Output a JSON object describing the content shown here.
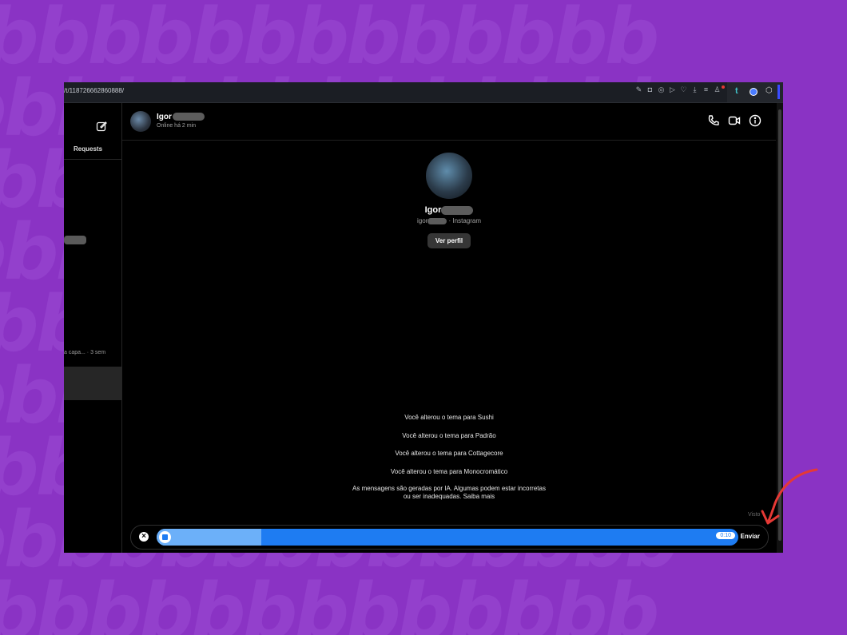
{
  "browser": {
    "url": "/t/118726662860888/",
    "extension_label": "t"
  },
  "sidebar": {
    "requests_label": "Requests",
    "snippet": "a capa... · 3 sem"
  },
  "chat": {
    "header": {
      "name": "Igor",
      "status": "Online há 2 min"
    },
    "profile": {
      "name": "Igor",
      "handle_prefix": "igor",
      "handle_suffix": "· Instagram",
      "view_profile_label": "Ver perfil"
    },
    "system_messages": [
      "Você alterou o tema para Sushi",
      "Você alterou o tema para Padrão",
      "Você alterou o tema para Cottagecore",
      "Você alterou o tema para Monocromático"
    ],
    "ai_notice_line1": "As mensagens são geradas por IA. Algumas podem estar incorretas",
    "ai_notice_line2": "ou ser inadequadas. Saiba mais",
    "seen_label": "Visto"
  },
  "composer": {
    "timer": "0:10",
    "send_label": "Enviar",
    "recording_progress": 0.18
  },
  "colors": {
    "background": "#8a33c4",
    "accent": "#1e7cf2",
    "arrow": "#e53935"
  }
}
